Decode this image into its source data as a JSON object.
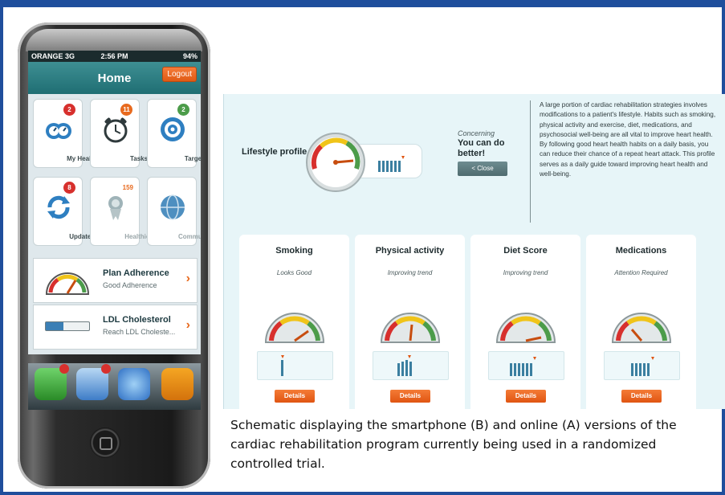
{
  "phone": {
    "status": {
      "carrier": "ORANGE 3G",
      "time": "2:56 PM",
      "battery": "94%"
    },
    "nav": {
      "title": "Home",
      "logout_label": "Logout"
    },
    "tiles": [
      {
        "label": "My Health",
        "badge": "2",
        "icon": "heart-gauge-icon"
      },
      {
        "label": "Tasks",
        "badge": "11",
        "icon": "alarm-clock-icon"
      },
      {
        "label": "Targets",
        "badge": "2",
        "icon": "target-icon"
      },
      {
        "label": "Updates",
        "badge": "8",
        "icon": "sync-icon"
      },
      {
        "label": "Healthies",
        "badge": "159",
        "icon": "award-ribbon-icon"
      },
      {
        "label": "Community",
        "badge": "",
        "icon": "globe-icon"
      }
    ],
    "cards": [
      {
        "title": "Plan Adherence",
        "subtitle": "Good Adherence"
      },
      {
        "title": "LDL Cholesterol",
        "subtitle": "Reach LDL Choleste..."
      }
    ],
    "dock": [
      "phone-app-icon",
      "mail-app-icon",
      "safari-app-icon",
      "ipod-app-icon"
    ]
  },
  "web": {
    "lifestyle_label": "Lifestyle profile",
    "concern_label": "Concerning",
    "headline": "You can do better!",
    "close_label": "< Close",
    "description": "A large portion of cardiac rehabilitation strategies involves modifications to a patient's lifestyle. Habits such as smoking, physical activity and exercise, diet, medications, and psychosocial well-being are all vital to improve heart health. By following good heart health habits on a daily basis, you can reduce their chance of a repeat heart attack. This profile serves as a daily guide toward improving heart health and well-being.",
    "metrics": [
      {
        "title": "Smoking",
        "status": "Looks Good",
        "details_label": "Details"
      },
      {
        "title": "Physical activity",
        "status": "Improving trend",
        "details_label": "Details"
      },
      {
        "title": "Diet Score",
        "status": "Improving trend",
        "details_label": "Details"
      },
      {
        "title": "Medications",
        "status": "Attention Required",
        "details_label": "Details"
      }
    ]
  },
  "caption": "Schematic displaying the smartphone (B) and online (A) versions of the cardiac rehabilitation program currently being used in a randomized controlled trial.",
  "colors": {
    "frame": "#1f4e9c",
    "accent": "#e86a1e",
    "teal": "#2e7f84"
  }
}
